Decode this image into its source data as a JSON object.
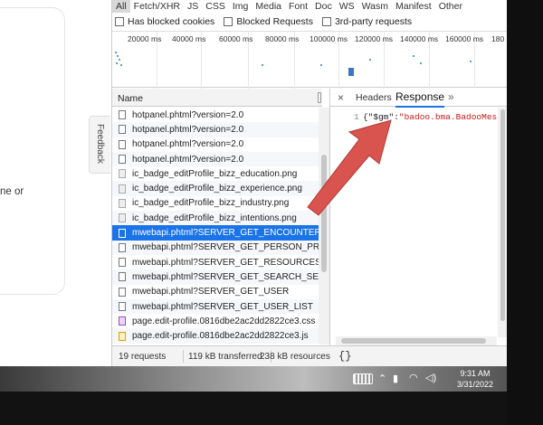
{
  "webpage": {
    "card_text": "ne or",
    "feedback_label": "Feedback"
  },
  "devtools": {
    "filter_types": [
      "All",
      "Fetch/XHR",
      "JS",
      "CSS",
      "Img",
      "Media",
      "Font",
      "Doc",
      "WS",
      "Wasm",
      "Manifest",
      "Other"
    ],
    "active_filter": "All",
    "checkboxes": [
      "Has blocked cookies",
      "Blocked Requests",
      "3rd-party requests"
    ],
    "timeline_ticks": [
      "20000 ms",
      "40000 ms",
      "60000 ms",
      "80000 ms",
      "100000 ms",
      "120000 ms",
      "140000 ms",
      "160000 ms",
      "180"
    ],
    "name_column_header": "Name",
    "requests": [
      {
        "name": "hotpanel.phtml?version=2.0",
        "type": "doc"
      },
      {
        "name": "hotpanel.phtml?version=2.0",
        "type": "doc"
      },
      {
        "name": "hotpanel.phtml?version=2.0",
        "type": "doc"
      },
      {
        "name": "hotpanel.phtml?version=2.0",
        "type": "doc"
      },
      {
        "name": "ic_badge_editProfile_bizz_education.png",
        "type": "img"
      },
      {
        "name": "ic_badge_editProfile_bizz_experience.png",
        "type": "img"
      },
      {
        "name": "ic_badge_editProfile_bizz_industry.png",
        "type": "img"
      },
      {
        "name": "ic_badge_editProfile_bizz_intentions.png",
        "type": "img"
      },
      {
        "name": "mwebapi.phtml?SERVER_GET_ENCOUNTERS",
        "type": "doc",
        "selected": true
      },
      {
        "name": "mwebapi.phtml?SERVER_GET_PERSON_PROFILE_E",
        "type": "doc"
      },
      {
        "name": "mwebapi.phtml?SERVER_GET_RESOURCES",
        "type": "doc"
      },
      {
        "name": "mwebapi.phtml?SERVER_GET_SEARCH_SETTINGS",
        "type": "doc"
      },
      {
        "name": "mwebapi.phtml?SERVER_GET_USER",
        "type": "doc"
      },
      {
        "name": "mwebapi.phtml?SERVER_GET_USER_LIST",
        "type": "doc"
      },
      {
        "name": "page.edit-profile.0816dbe2ac2dd2822ce3.css",
        "type": "css"
      },
      {
        "name": "page.edit-profile.0816dbe2ac2dd2822ce3.js",
        "type": "js"
      }
    ],
    "response_panel": {
      "close_label": "×",
      "tab_headers": "Headers",
      "tab_response": "Response",
      "more_tabs": "»",
      "line_number": "1",
      "code_key": "{\"$gm\":",
      "code_value": "\"badoo.bma.BadooMess"
    },
    "status": {
      "requests": "19 requests",
      "transferred": "119 kB transferred",
      "resources": "238 kB resources",
      "format_button": "{}"
    }
  },
  "taskbar": {
    "time": "9:31 AM",
    "date": "3/31/2022",
    "tray_icons": [
      "keyboard-icon",
      "chevron-up-icon",
      "battery-icon",
      "wifi-icon",
      "volume-icon"
    ]
  },
  "colors": {
    "selection": "#1a73e8",
    "arrow": "#d9534f"
  }
}
